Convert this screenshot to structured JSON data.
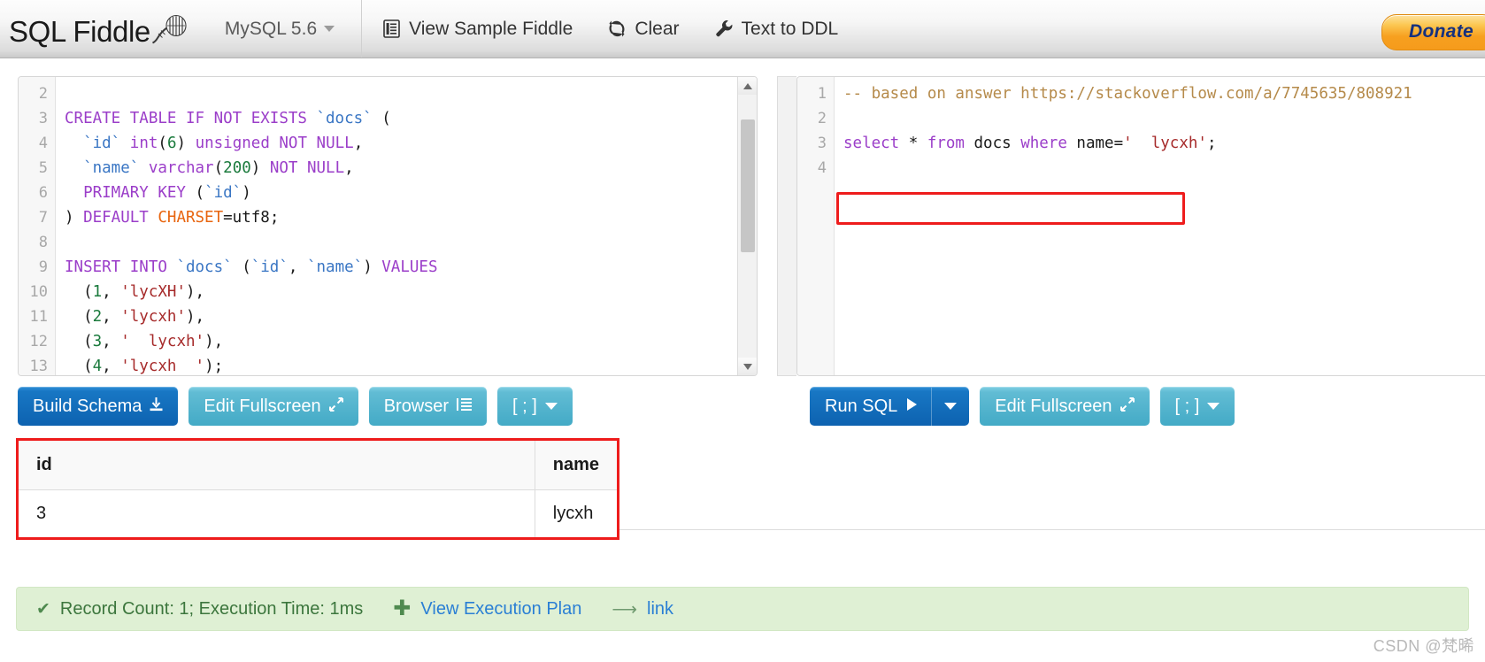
{
  "header": {
    "brand": "SQL Fiddle",
    "brand_logo_icon": "fiddle-violin-icon",
    "db_select": {
      "value": "MySQL 5.6",
      "caret_icon": "chevron-down-icon"
    },
    "items": [
      {
        "label": "View Sample Fiddle",
        "icon": "list-document-icon"
      },
      {
        "label": "Clear",
        "icon": "refresh-icon"
      },
      {
        "label": "Text to DDL",
        "icon": "wrench-icon"
      }
    ],
    "donate_label": "Donate"
  },
  "schema_editor": {
    "lines": [
      {
        "num": "2",
        "tokens": []
      },
      {
        "num": "3",
        "tokens": [
          {
            "t": "CREATE TABLE IF NOT EXISTS ",
            "c": "kw"
          },
          {
            "t": "`docs`",
            "c": "ident"
          },
          {
            "t": " (",
            "c": "plain"
          }
        ]
      },
      {
        "num": "4",
        "tokens": [
          {
            "t": "  ",
            "c": "plain"
          },
          {
            "t": "`id`",
            "c": "ident"
          },
          {
            "t": " ",
            "c": "plain"
          },
          {
            "t": "int",
            "c": "kw"
          },
          {
            "t": "(",
            "c": "plain"
          },
          {
            "t": "6",
            "c": "num"
          },
          {
            "t": ") ",
            "c": "plain"
          },
          {
            "t": "unsigned NOT NULL",
            "c": "kw"
          },
          {
            "t": ",",
            "c": "plain"
          }
        ]
      },
      {
        "num": "5",
        "tokens": [
          {
            "t": "  ",
            "c": "plain"
          },
          {
            "t": "`name`",
            "c": "ident"
          },
          {
            "t": " ",
            "c": "plain"
          },
          {
            "t": "varchar",
            "c": "kw"
          },
          {
            "t": "(",
            "c": "plain"
          },
          {
            "t": "200",
            "c": "num"
          },
          {
            "t": ") ",
            "c": "plain"
          },
          {
            "t": "NOT NULL",
            "c": "kw"
          },
          {
            "t": ",",
            "c": "plain"
          }
        ]
      },
      {
        "num": "6",
        "tokens": [
          {
            "t": "  ",
            "c": "plain"
          },
          {
            "t": "PRIMARY KEY",
            "c": "kw"
          },
          {
            "t": " (",
            "c": "plain"
          },
          {
            "t": "`id`",
            "c": "ident"
          },
          {
            "t": ")",
            "c": "plain"
          }
        ]
      },
      {
        "num": "7",
        "tokens": [
          {
            "t": ") ",
            "c": "plain"
          },
          {
            "t": "DEFAULT ",
            "c": "kw"
          },
          {
            "t": "CHARSET",
            "c": "orng"
          },
          {
            "t": "=utf8;",
            "c": "plain"
          }
        ]
      },
      {
        "num": "8",
        "tokens": []
      },
      {
        "num": "9",
        "tokens": [
          {
            "t": "INSERT INTO ",
            "c": "kw"
          },
          {
            "t": "`docs`",
            "c": "ident"
          },
          {
            "t": " (",
            "c": "plain"
          },
          {
            "t": "`id`",
            "c": "ident"
          },
          {
            "t": ", ",
            "c": "plain"
          },
          {
            "t": "`name`",
            "c": "ident"
          },
          {
            "t": ") ",
            "c": "plain"
          },
          {
            "t": "VALUES",
            "c": "kw"
          }
        ]
      },
      {
        "num": "10",
        "tokens": [
          {
            "t": "  (",
            "c": "plain"
          },
          {
            "t": "1",
            "c": "num"
          },
          {
            "t": ", ",
            "c": "plain"
          },
          {
            "t": "'lycXH'",
            "c": "str"
          },
          {
            "t": "),",
            "c": "plain"
          }
        ]
      },
      {
        "num": "11",
        "tokens": [
          {
            "t": "  (",
            "c": "plain"
          },
          {
            "t": "2",
            "c": "num"
          },
          {
            "t": ", ",
            "c": "plain"
          },
          {
            "t": "'lycxh'",
            "c": "str"
          },
          {
            "t": "),",
            "c": "plain"
          }
        ]
      },
      {
        "num": "12",
        "tokens": [
          {
            "t": "  (",
            "c": "plain"
          },
          {
            "t": "3",
            "c": "num"
          },
          {
            "t": ", ",
            "c": "plain"
          },
          {
            "t": "'  lycxh'",
            "c": "str"
          },
          {
            "t": "),",
            "c": "plain"
          }
        ]
      },
      {
        "num": "13",
        "tokens": [
          {
            "t": "  (",
            "c": "plain"
          },
          {
            "t": "4",
            "c": "num"
          },
          {
            "t": ", ",
            "c": "plain"
          },
          {
            "t": "'lycxh  '",
            "c": "str"
          },
          {
            "t": ");",
            "c": "plain"
          }
        ]
      }
    ],
    "buttons": [
      {
        "label": "Build Schema",
        "icon": "download-icon",
        "style": "primary"
      },
      {
        "label": "Edit Fullscreen",
        "icon": "expand-arrows-icon",
        "style": "info"
      },
      {
        "label": "Browser",
        "icon": "indent-list-icon",
        "style": "info"
      },
      {
        "label": "[ ; ]",
        "icon": "chevron-down-icon",
        "style": "info"
      }
    ]
  },
  "query_editor": {
    "lines": [
      {
        "num": "1",
        "tokens": [
          {
            "t": "-- based on answer https://stackoverflow.com/a/7745635/808921",
            "c": "cmt"
          }
        ]
      },
      {
        "num": "2",
        "tokens": []
      },
      {
        "num": "3",
        "tokens": [
          {
            "t": "select",
            "c": "kw"
          },
          {
            "t": " * ",
            "c": "plain"
          },
          {
            "t": "from",
            "c": "kw"
          },
          {
            "t": " docs ",
            "c": "plain"
          },
          {
            "t": "where",
            "c": "kw"
          },
          {
            "t": " name=",
            "c": "plain"
          },
          {
            "t": "'  lycxh'",
            "c": "str"
          },
          {
            "t": ";",
            "c": "plain"
          }
        ]
      },
      {
        "num": "4",
        "tokens": []
      }
    ],
    "buttons": [
      {
        "label": "Run SQL",
        "icon": "play-icon",
        "style": "primary"
      },
      {
        "label": "Edit Fullscreen",
        "icon": "expand-arrows-icon",
        "style": "info"
      },
      {
        "label": "[ ; ]",
        "icon": "chevron-down-icon",
        "style": "info"
      }
    ]
  },
  "results": {
    "columns": [
      "id",
      "name"
    ],
    "rows": [
      [
        "3",
        "lycxh"
      ]
    ]
  },
  "status": {
    "record_text": "Record Count: 1; Execution Time: 1ms",
    "check_icon": "check-icon",
    "exec_plan_label": "View Execution Plan",
    "exec_plan_icon": "plus-icon",
    "link_label": "link",
    "link_icon": "share-arrow-icon"
  },
  "watermark": "CSDN @梵晞",
  "colors": {
    "primary_blue": "#0d62b0",
    "info_blue": "#43aac6",
    "annotation_red": "#ee1c1c",
    "status_green_bg": "#dff0d4",
    "status_green_text": "#3c763d",
    "donate_orange": "#f7a01f"
  }
}
